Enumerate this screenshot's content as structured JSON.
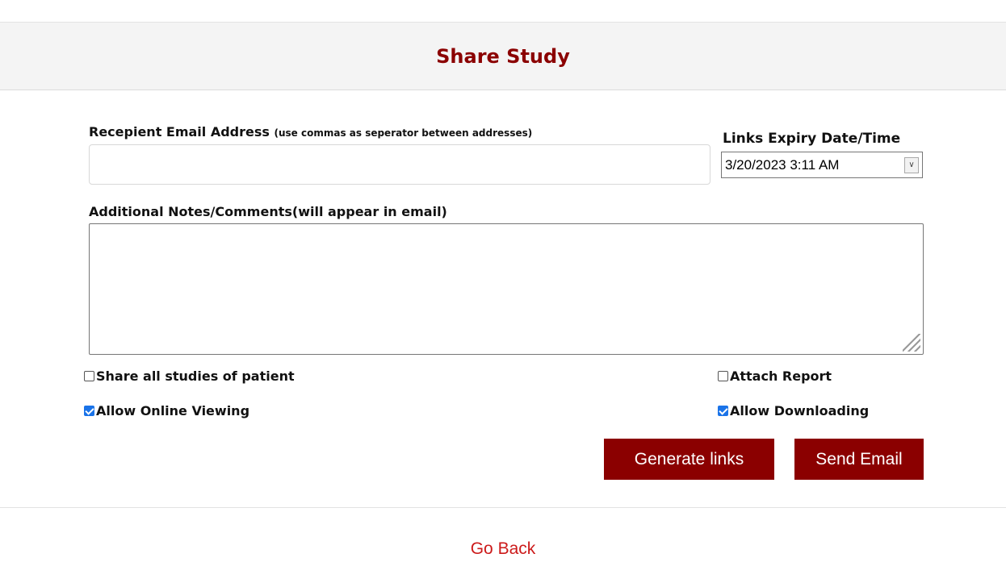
{
  "header": {
    "title": "Share Study"
  },
  "form": {
    "email_label": "Recepient Email Address",
    "email_hint": "(use commas as seperator between addresses)",
    "email_value": "",
    "expiry_label": "Links Expiry Date/Time",
    "expiry_value": "3/20/2023 3:11 AM",
    "notes_label": "Additional Notes/Comments(will appear in email)",
    "notes_value": ""
  },
  "options": {
    "share_all": {
      "label": "Share all studies of patient",
      "checked": false
    },
    "attach_report": {
      "label": "Attach Report",
      "checked": false
    },
    "allow_online": {
      "label": "Allow Online Viewing",
      "checked": true
    },
    "allow_download": {
      "label": "Allow Downloading",
      "checked": true
    }
  },
  "buttons": {
    "generate_label": "Generate links",
    "send_label": "Send Email"
  },
  "footer": {
    "go_back_label": "Go Back"
  },
  "colors": {
    "accent": "#8b0000",
    "link": "#cc1a1a",
    "check": "#1a73e8"
  }
}
